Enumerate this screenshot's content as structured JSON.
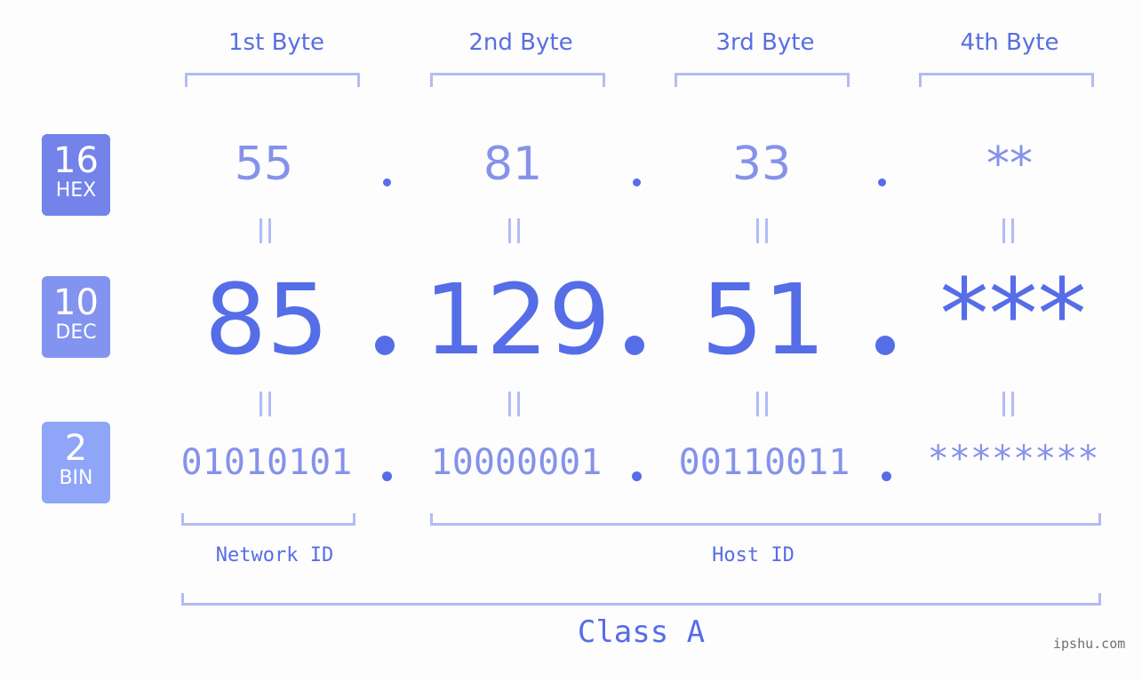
{
  "bytes": [
    {
      "label": "1st Byte",
      "hex": "55",
      "dec": "85",
      "bin": "01010101"
    },
    {
      "label": "2nd Byte",
      "hex": "81",
      "dec": "129",
      "bin": "10000001"
    },
    {
      "label": "3rd Byte",
      "hex": "33",
      "dec": "51",
      "bin": "00110011"
    },
    {
      "label": "4th Byte",
      "hex": "**",
      "dec": "***",
      "bin": "********"
    }
  ],
  "bases": [
    {
      "num": "16",
      "name": "HEX",
      "color": "#7383ea"
    },
    {
      "num": "10",
      "name": "DEC",
      "color": "#8293f0"
    },
    {
      "num": "2",
      "name": "BIN",
      "color": "#8ea5f8"
    }
  ],
  "equals": "=",
  "network_id": "Network ID",
  "host_id": "Host ID",
  "class_label": "Class A",
  "watermark": "ipshu.com"
}
